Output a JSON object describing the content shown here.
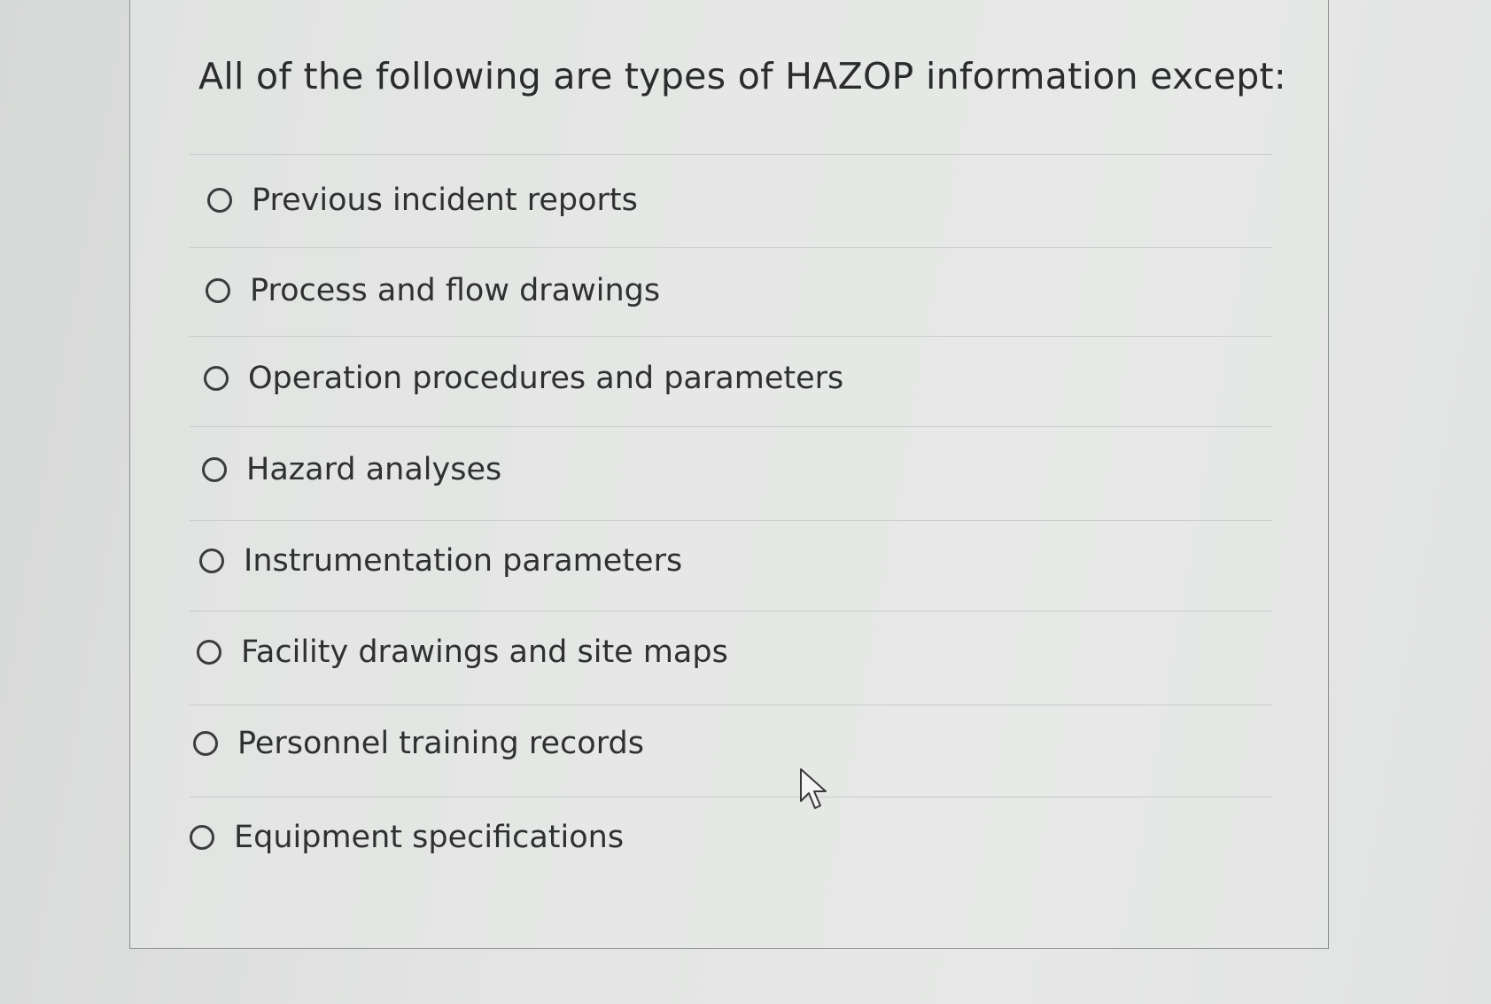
{
  "question": {
    "prompt": "All of the following are types of HAZOP information except:"
  },
  "options": [
    {
      "label": "Previous incident reports",
      "selected": false
    },
    {
      "label": "Process and flow drawings",
      "selected": false
    },
    {
      "label": "Operation procedures and parameters",
      "selected": false
    },
    {
      "label": "Hazard analyses",
      "selected": false
    },
    {
      "label": "Instrumentation parameters",
      "selected": false
    },
    {
      "label": "Facility drawings and site maps",
      "selected": false
    },
    {
      "label": "Personnel training records",
      "selected": false
    },
    {
      "label": "Equipment specifications",
      "selected": false
    }
  ],
  "icons": {
    "radio": "radio-unchecked-icon",
    "cursor": "mouse-pointer-icon"
  },
  "colors": {
    "text": "#2f3030",
    "divider": "#c9cbca",
    "border": "#8d8f8e"
  }
}
